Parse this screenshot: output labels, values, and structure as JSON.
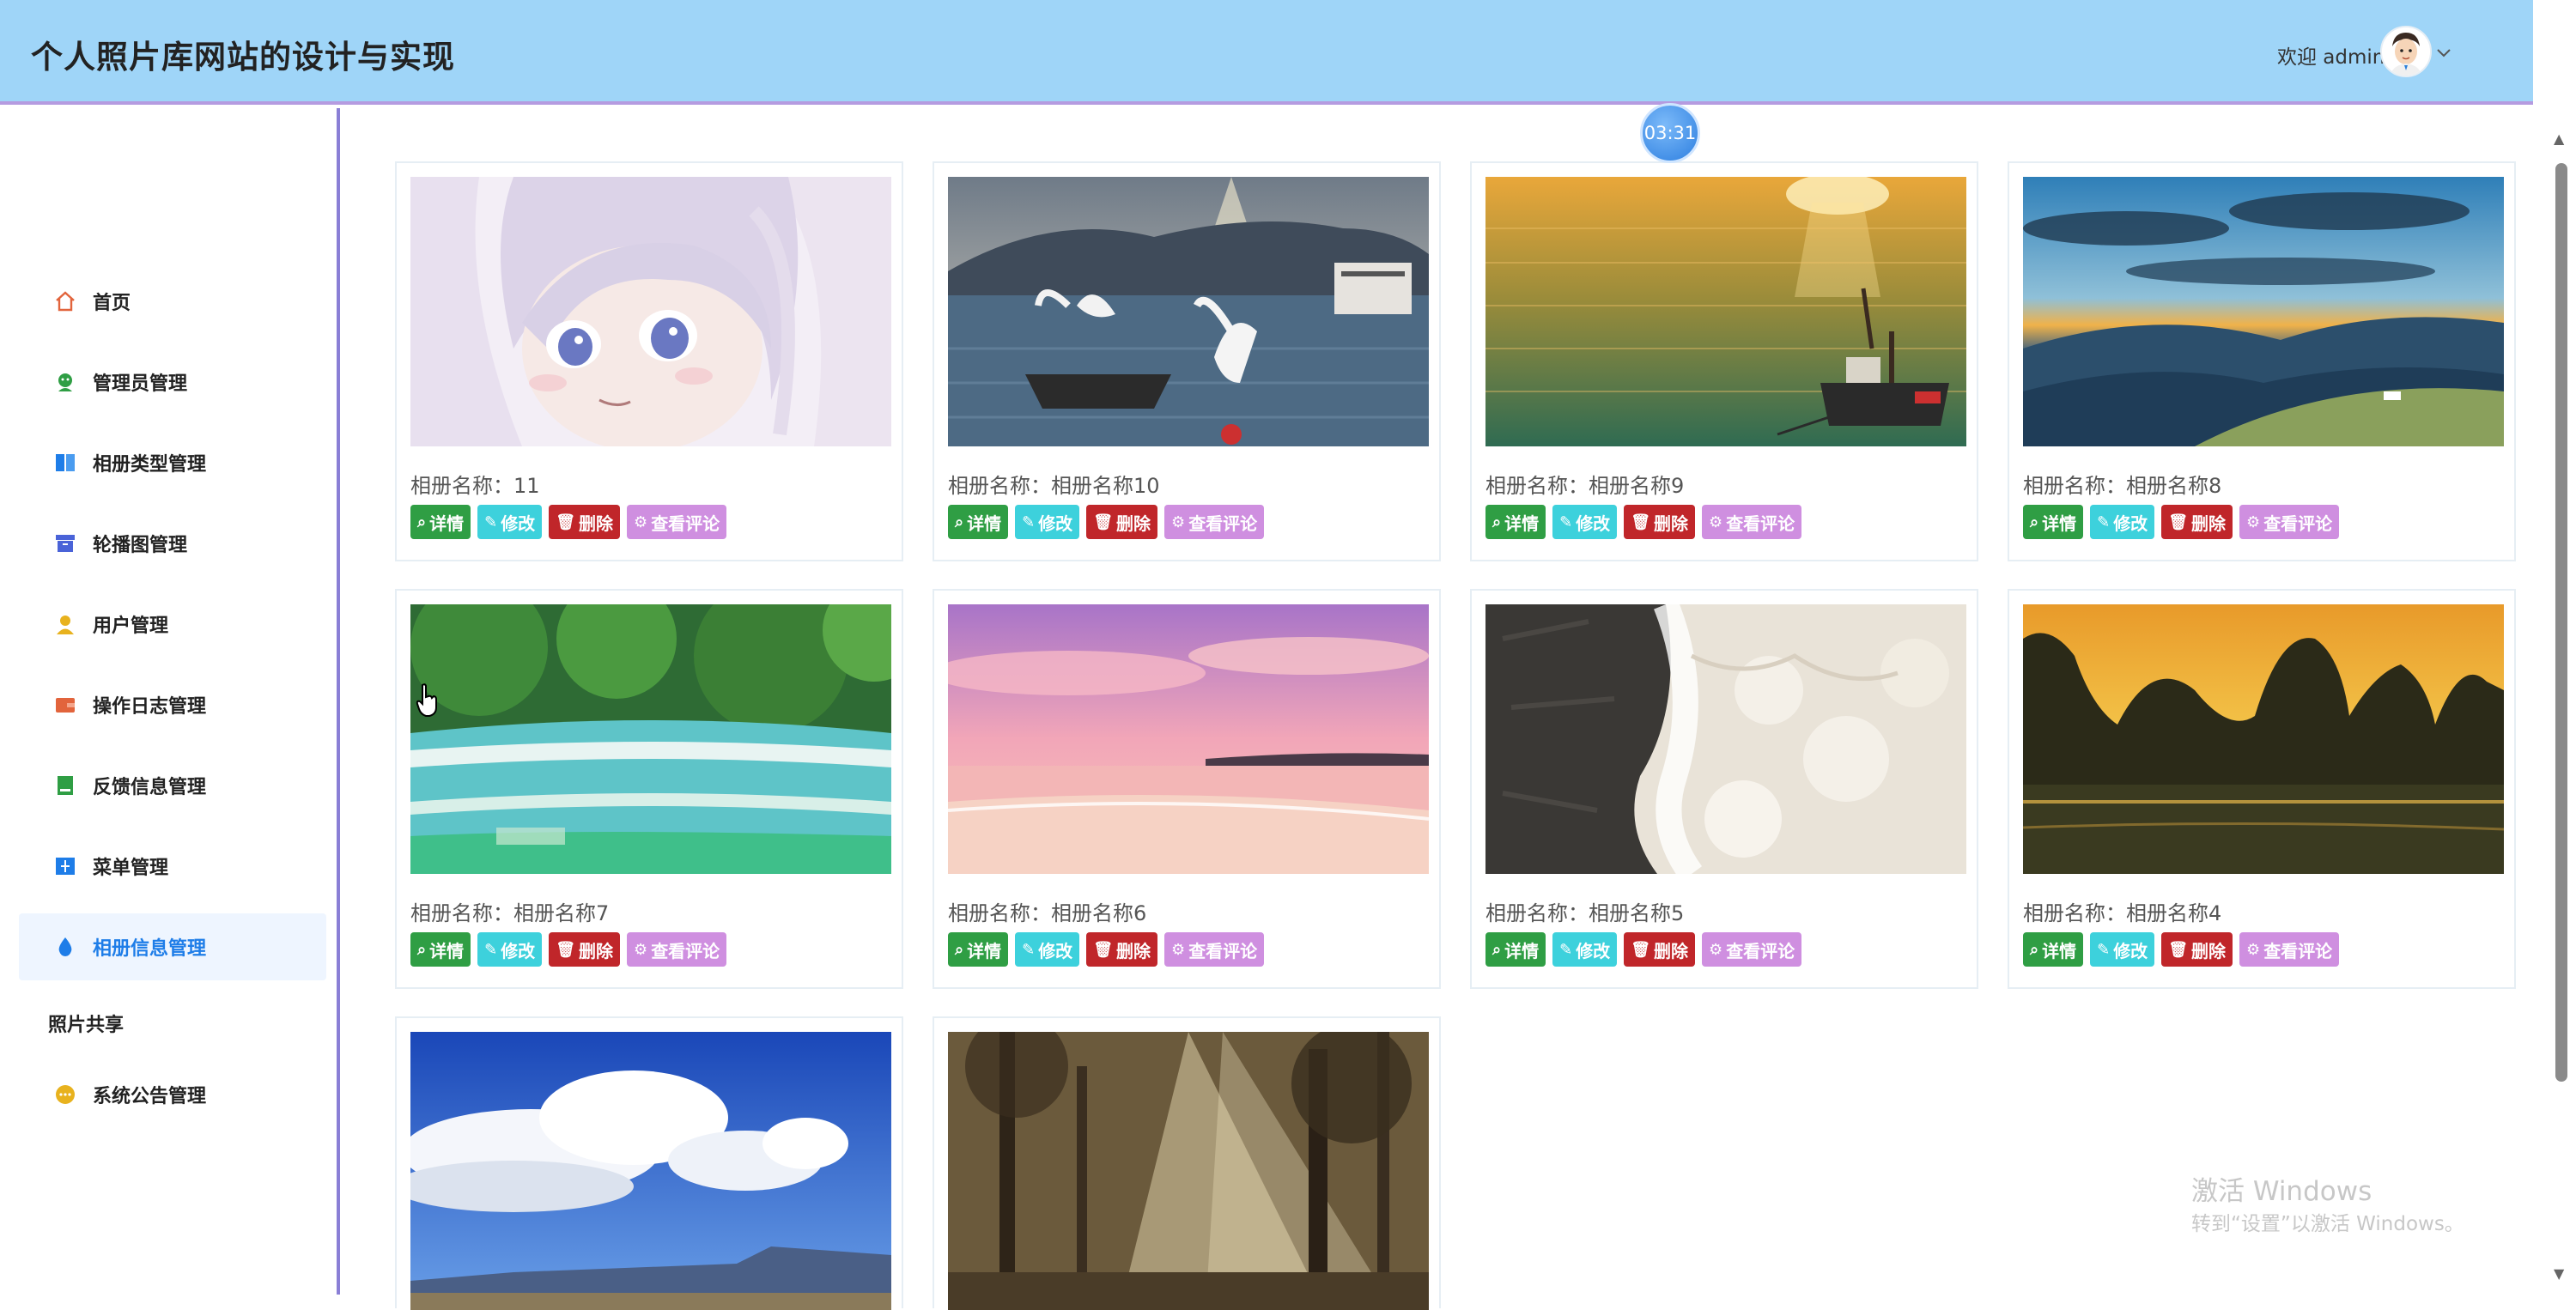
{
  "header": {
    "title": "个人照片库网站的设计与实现",
    "welcome": "欢迎 admin",
    "dropdown_icon": "chevron-down-icon"
  },
  "timer": "03:31",
  "sidebar": {
    "items": [
      {
        "label": "首页",
        "icon": "home-icon",
        "color": "#e2643c"
      },
      {
        "label": "管理员管理",
        "icon": "admin-icon",
        "color": "#2f9e44"
      },
      {
        "label": "相册类型管理",
        "icon": "book-icon",
        "color": "#1e7de8"
      },
      {
        "label": "轮播图管理",
        "icon": "archive-icon",
        "color": "#4a63d8"
      },
      {
        "label": "用户管理",
        "icon": "user-icon",
        "color": "#e8b21e"
      },
      {
        "label": "操作日志管理",
        "icon": "wallet-icon",
        "color": "#e2643c"
      },
      {
        "label": "反馈信息管理",
        "icon": "document-icon",
        "color": "#2f9e44"
      },
      {
        "label": "菜单管理",
        "icon": "split-icon",
        "color": "#1e7de8"
      },
      {
        "label": "相册信息管理",
        "icon": "drop-icon",
        "color": "#1e7de8",
        "active": true
      },
      {
        "label": "照片共享",
        "icon": "",
        "color": ""
      },
      {
        "label": "系统公告管理",
        "icon": "chat-icon",
        "color": "#e8b21e"
      }
    ]
  },
  "cards": [
    {
      "caption": "相册名称：11",
      "photo": "anime-girl"
    },
    {
      "caption": "相册名称：相册名称10",
      "photo": "seagulls-lake"
    },
    {
      "caption": "相册名称：相册名称9",
      "photo": "sunset-sea-boat"
    },
    {
      "caption": "相册名称：相册名称8",
      "photo": "mountain-dusk"
    },
    {
      "caption": "相册名称：相册名称7",
      "photo": "turquoise-pools"
    },
    {
      "caption": "相册名称：相册名称6",
      "photo": "pink-beach"
    },
    {
      "caption": "相册名称：相册名称5",
      "photo": "rock-waves"
    },
    {
      "caption": "相册名称：相册名称4",
      "photo": "karst-sunset"
    },
    {
      "caption": "",
      "photo": "blue-sky-clouds"
    },
    {
      "caption": "",
      "photo": "misty-forest"
    }
  ],
  "buttons": {
    "detail": "详情",
    "edit": "修改",
    "delete": "删除",
    "comments": "查看评论"
  },
  "watermark": {
    "line1": "激活 Windows",
    "line2": "转到“设置”以激活 Windows。"
  },
  "colors": {
    "header_bg": "#9fd5f8",
    "accent": "#8a7fd6",
    "active_menu": "#1e7de8"
  }
}
